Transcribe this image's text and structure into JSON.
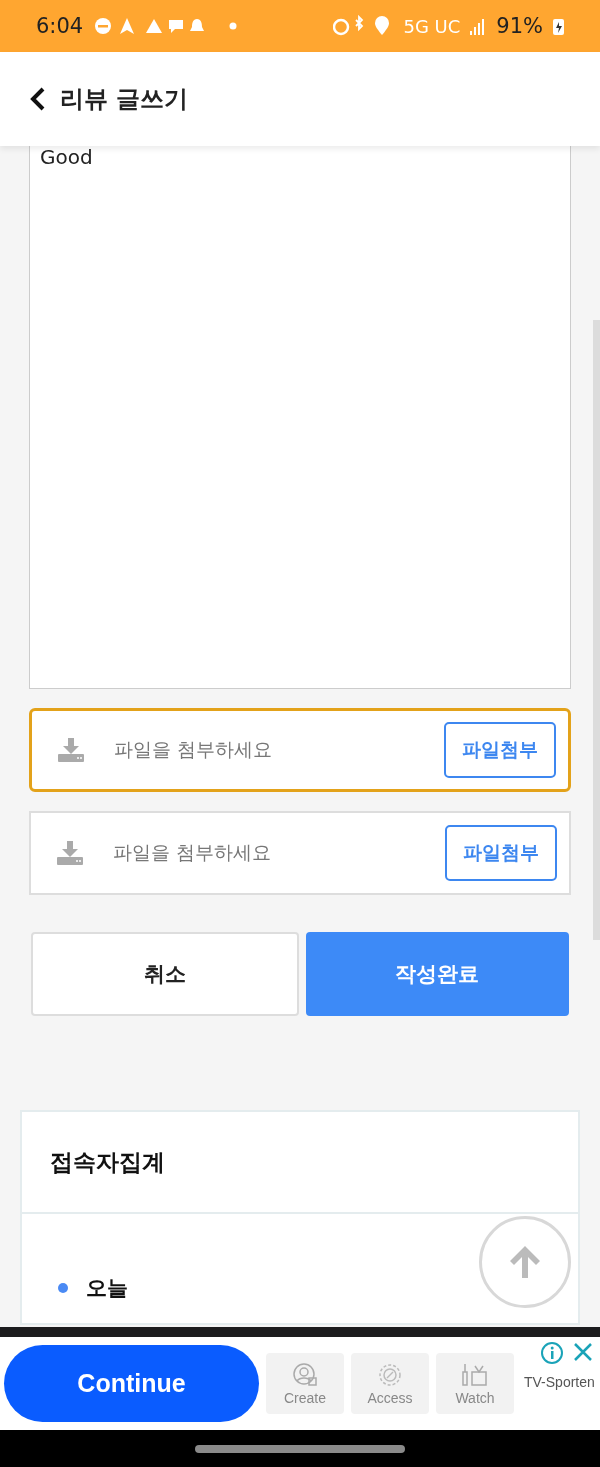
{
  "status_bar": {
    "time": "6:04",
    "network": "5G UC",
    "battery": "91%"
  },
  "header": {
    "title": "리뷰 글쓰기"
  },
  "review": {
    "value": "Good"
  },
  "attachments": [
    {
      "placeholder": "파일을 첨부하세요",
      "button": "파일첨부",
      "focused": true
    },
    {
      "placeholder": "파일을 첨부하세요",
      "button": "파일첨부",
      "focused": false
    }
  ],
  "actions": {
    "cancel": "취소",
    "submit": "작성완료"
  },
  "stats": {
    "title": "접속자집계",
    "items": [
      {
        "label": "오늘",
        "color": "#4a8af4"
      }
    ]
  },
  "ad": {
    "cta": "Continue",
    "tiles": [
      {
        "label": "Create",
        "kind": "person"
      },
      {
        "label": "Access",
        "kind": "gear"
      },
      {
        "label": "Watch",
        "kind": "watch"
      }
    ],
    "brand": "TV-Sporten"
  }
}
